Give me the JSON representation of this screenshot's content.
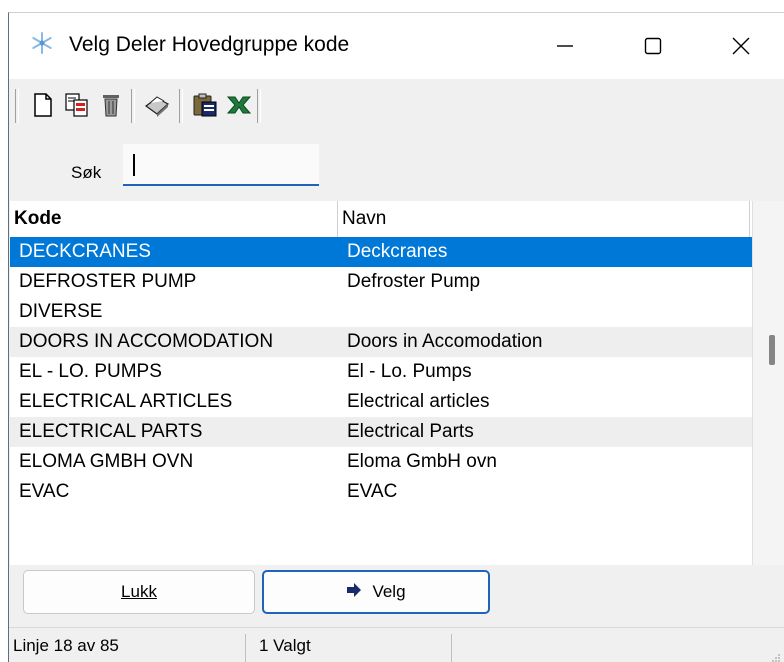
{
  "window": {
    "title": "Velg Deler Hovedgruppe kode",
    "app_icon": "snowflake-icon",
    "controls": [
      "minimize-icon",
      "maximize-icon",
      "close-icon"
    ]
  },
  "toolbar": {
    "buttons": [
      "new-document-icon",
      "copy-icon",
      "delete-icon",
      "print-icon",
      "paste-icon",
      "excel-export-icon"
    ]
  },
  "search": {
    "label": "Søk",
    "value": ""
  },
  "grid": {
    "columns": [
      "Kode",
      "Navn"
    ],
    "selected_index": 0,
    "rows": [
      {
        "kode": "DECKCRANES",
        "navn": "Deckcranes"
      },
      {
        "kode": "DEFROSTER PUMP",
        "navn": "Defroster Pump"
      },
      {
        "kode": "DIVERSE",
        "navn": ""
      },
      {
        "kode": "DOORS IN ACCOMODATION",
        "navn": "Doors in Accomodation"
      },
      {
        "kode": "EL - LO. PUMPS",
        "navn": "El - Lo. Pumps"
      },
      {
        "kode": "ELECTRICAL ARTICLES",
        "navn": "Electrical articles"
      },
      {
        "kode": "ELECTRICAL PARTS",
        "navn": "Electrical Parts"
      },
      {
        "kode": "ELOMA GMBH OVN",
        "navn": "Eloma GmbH ovn"
      },
      {
        "kode": "EVAC",
        "navn": "EVAC"
      }
    ]
  },
  "buttons": {
    "lukk": "Lukk",
    "velg": "Velg"
  },
  "status": {
    "line": "Linje 18 av 85",
    "selected": "1 Valgt"
  },
  "colors": {
    "selection": "#0078d7",
    "accent": "#1f64b6",
    "alt_row": "#eeeeee"
  }
}
